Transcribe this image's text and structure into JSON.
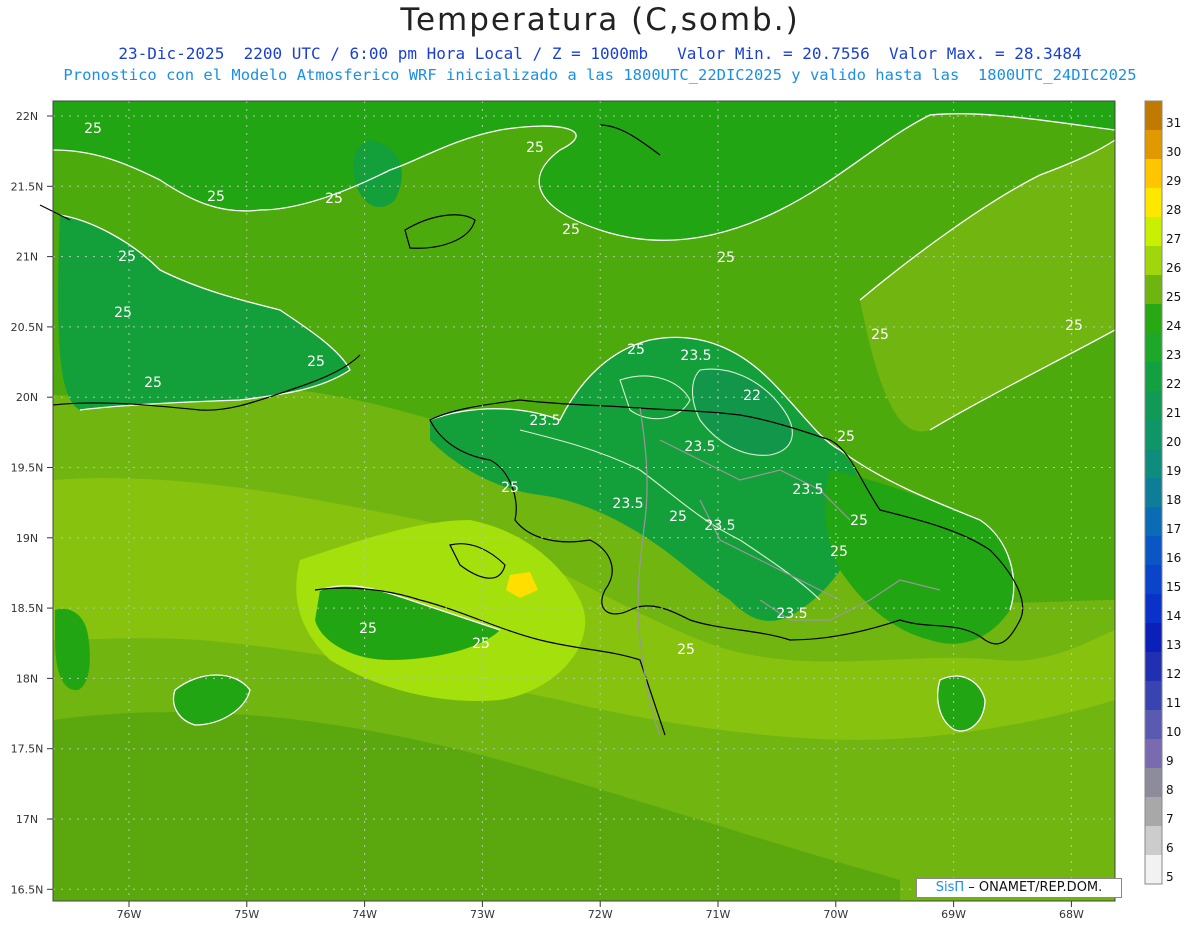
{
  "header": {
    "title": "Temperatura (C,somb.)",
    "line1": "23-Dic-2025  2200 UTC / 6:00 pm Hora Local / Z = 1000mb   Valor Min. = 20.7556  Valor Max. = 28.3484",
    "line2": "Pronostico con el Modelo Atmosferico WRF inicializado a las 1800UTC_22DIC2025 y valido hasta las  1800UTC_24DIC2025"
  },
  "map": {
    "lat_ticks": [
      "22N",
      "21.5N",
      "21N",
      "20.5N",
      "20N",
      "19.5N",
      "19N",
      "18.5N",
      "18N",
      "17.5N",
      "17N",
      "16.5N"
    ],
    "lon_ticks": [
      "76W",
      "75W",
      "74W",
      "73W",
      "72W",
      "71W",
      "70W",
      "69W",
      "68W"
    ],
    "contour_labels": [
      "25",
      "25",
      "25",
      "25",
      "25",
      "25",
      "25",
      "25",
      "25",
      "25",
      "25",
      "25",
      "23.5",
      "23.5",
      "22",
      "25",
      "23.5",
      "23.5",
      "23.5",
      "25",
      "23.5",
      "25",
      "25",
      "23.5",
      "25",
      "25",
      "25",
      "25",
      "25"
    ],
    "colors": {
      "c25": "#4daa0c",
      "c26": "#70b510",
      "c27": "#86c20e",
      "c28": "#a4e00c",
      "c24": "#22a512",
      "c23": "#139f3a",
      "c22": "#11964a",
      "c21": "#0f8a4a",
      "hot": "#ffde00",
      "coast": "#000000",
      "border": "#999999"
    }
  },
  "colorbar": {
    "levels": [
      "31",
      "30",
      "29",
      "28",
      "27",
      "26",
      "25",
      "24",
      "23",
      "22",
      "21",
      "20",
      "19",
      "18",
      "17",
      "16",
      "15",
      "14",
      "13",
      "12",
      "11",
      "10",
      "9",
      "8",
      "7",
      "6",
      "5"
    ],
    "colors": [
      "#c07a00",
      "#e09a00",
      "#ffc600",
      "#ffe800",
      "#c8f000",
      "#9fd60c",
      "#6fb510",
      "#28a812",
      "#1ea82a",
      "#13a040",
      "#109a55",
      "#0f9668",
      "#0e8c7c",
      "#0e7e98",
      "#0a6cb4",
      "#0a56c4",
      "#0a44c8",
      "#0a32c8",
      "#0a20b8",
      "#2030b0",
      "#3a44b0",
      "#5a5ab0",
      "#7a6ab0",
      "#8c8c9a",
      "#a8a8a8",
      "#cccccc",
      "#f2f2f2"
    ]
  },
  "credit": {
    "logo": "SisΠ",
    "text": " – ONAMET/REP.DOM."
  }
}
